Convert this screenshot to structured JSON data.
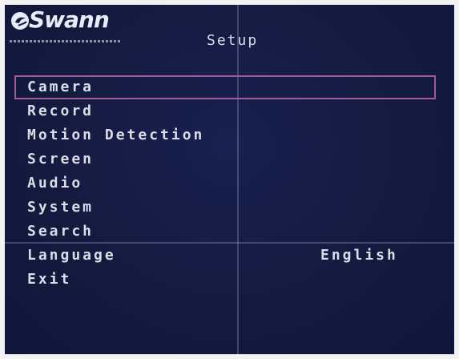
{
  "brand": {
    "name": "Swann"
  },
  "header": {
    "title": "Setup"
  },
  "menu": {
    "items": [
      {
        "label": "Camera",
        "value": ""
      },
      {
        "label": "Record",
        "value": ""
      },
      {
        "label": "Motion Detection",
        "value": ""
      },
      {
        "label": "Screen",
        "value": ""
      },
      {
        "label": "Audio",
        "value": ""
      },
      {
        "label": "System",
        "value": ""
      },
      {
        "label": "Search",
        "value": ""
      },
      {
        "label": "Language",
        "value": "English"
      },
      {
        "label": "Exit",
        "value": ""
      }
    ],
    "selected_index": 0
  },
  "colors": {
    "background": "#141a3e",
    "text": "#dadde8",
    "selection_border": "#a25a98",
    "crosshair": "#8890b8"
  },
  "icons": {
    "logo": "swann-logo-icon"
  }
}
